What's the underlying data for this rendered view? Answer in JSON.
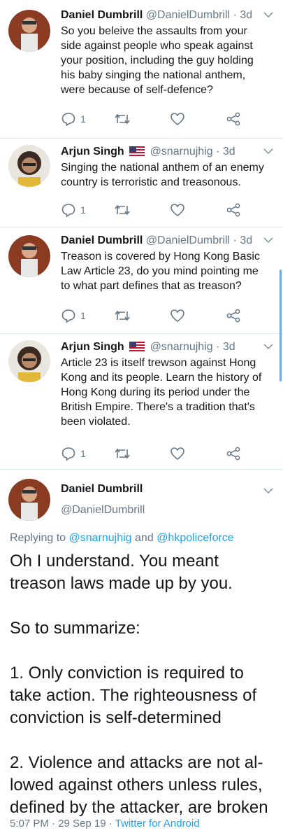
{
  "tweets": [
    {
      "name": "Daniel Dumbrill",
      "handle": "@DanielDumbrill",
      "time": "3d",
      "text_lines": [
        "So you beleive the assaults from your",
        "side against people who speak against",
        "your position, including the guy holding",
        "his baby singing the national anthem,",
        "were because of self-defence?"
      ],
      "replies": "1"
    },
    {
      "name": "Arjun Singh",
      "handle": "@snarnujhig",
      "time": "3d",
      "text_lines": [
        "Singing the national anthem of an enemy",
        "country is terroristic and treasonous."
      ],
      "replies": "1"
    },
    {
      "name": "Daniel Dumbrill",
      "handle": "@DanielDumbrill",
      "time": "3d",
      "text_lines": [
        "Treason is covered by Hong Kong Basic",
        "Law Article 23, do you mind pointing me",
        "to what part defines that as treason?"
      ],
      "replies": "1"
    },
    {
      "name": "Arjun Singh",
      "handle": "@snarnujhig",
      "time": "3d",
      "text_lines": [
        "Article 23 is itself trewson against Hong",
        "Kong and its people. Learn the history of",
        "Hong Kong during its period under the",
        "British Empire. There's a tradition that's",
        "been violated."
      ],
      "replies": "1"
    }
  ],
  "main": {
    "name": "Daniel Dumbrill",
    "handle": "@DanielDumbrill",
    "replying_prefix": "Replying to",
    "mention1": "@snarnujhig",
    "and": "and",
    "mention2": "@hkpoliceforce",
    "paragraphs": [
      [
        "Oh I understand. You meant",
        "treason laws made up by you."
      ],
      [
        "So to summarize:"
      ],
      [
        "1. Only conviction is required to",
        "take action. The righteousness of",
        "conviction is self-determined"
      ],
      [
        "2. Violence and attacks are not al-",
        "lowed against others unless rules,",
        "defined by the attacker, are broken"
      ]
    ],
    "timestamp": "5:07 PM · 29 Sep 19 ·",
    "source": "Twitter for Android"
  },
  "colors": {
    "accent": "#1da1f2",
    "muted": "#657786"
  }
}
